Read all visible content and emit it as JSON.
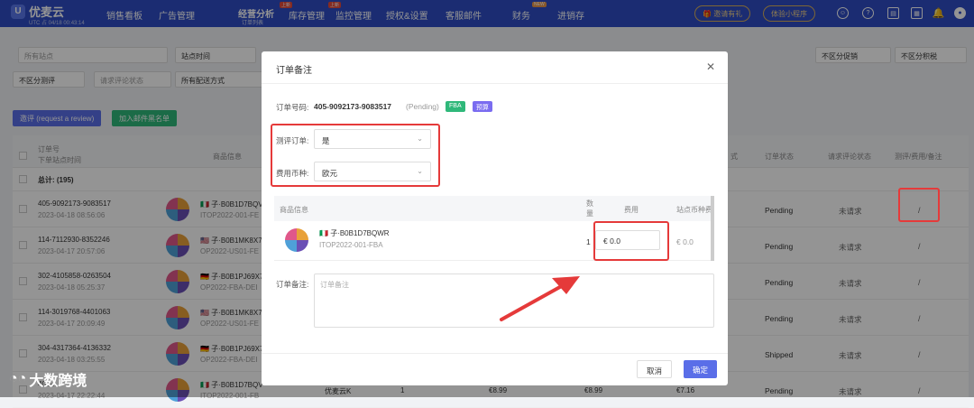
{
  "nav": {
    "logo": "优麦云",
    "logo_sub": "UTC 占 04/18 00:43:14",
    "items": [
      "销售看板",
      "广告管理",
      "经营分析",
      "库存管理",
      "监控管理",
      "授权&设置",
      "客服邮件",
      "财务",
      "进销存"
    ],
    "active_sub": "订单列表",
    "badge_new1": "上新",
    "badge_new2": "上新",
    "badge_new3": "NEW",
    "invite": "邀请有礼",
    "mini_program": "体验小程序"
  },
  "filters": {
    "row1": [
      "所有站点",
      "站点时间",
      "不区分促销",
      "不区分积税"
    ],
    "row2": [
      "不区分测评",
      "请求评论状态",
      "所有配送方式"
    ],
    "btn_review": "邀评 (request a review)",
    "btn_blacklist": "加入邮件黑名单"
  },
  "table": {
    "headers": {
      "order_no": "订单号",
      "order_time": "下单站点时间",
      "product": "商品信息",
      "ship": "式",
      "status": "订单状态",
      "review": "请求评论状态",
      "remark": "测评/费用/备注"
    },
    "total": "总计: (195)",
    "rows": [
      {
        "no": "405-9092173-9083517",
        "date": "2023-04-18 08:56:06",
        "sku": "B0B1D7BQV",
        "msku": "ITOP2022-001-FE",
        "status": "Pending",
        "review": "未请求",
        "remark": "/"
      },
      {
        "no": "114-7112930-8352246",
        "date": "2023-04-17 20:57:06",
        "sku": "B0B1MK8X7",
        "msku": "OP2022-US01-FE",
        "status": "Pending",
        "review": "未请求",
        "remark": "/"
      },
      {
        "no": "302-4105858-0263504",
        "date": "2023-04-18 05:25:37",
        "sku": "B0B1PJ69X7",
        "msku": "OP2022-FBA-DEI",
        "status": "Pending",
        "review": "未请求",
        "remark": "/"
      },
      {
        "no": "114-3019768-4401063",
        "date": "2023-04-17 20:09:49",
        "sku": "B0B1MK8X7",
        "msku": "OP2022-US01-FE",
        "status": "Pending",
        "review": "未请求",
        "remark": "/"
      },
      {
        "no": "304-4317364-4136332",
        "date": "2023-04-18 03:25:55",
        "sku": "B0B1PJ69X7",
        "msku": "OP2022-FBA-DEI",
        "status": "Shipped",
        "review": "未请求",
        "remark": "/"
      },
      {
        "no": "405-...",
        "date": "2023-04-17 22:22:44",
        "sku": "B0B1D7BQV",
        "msku": "ITOP2022-001-FB",
        "status": "Pending",
        "review": "未请求",
        "remark": "/"
      }
    ],
    "last_row_extra": {
      "shop": "优麦云K",
      "qty": "1",
      "price": "€8.99",
      "fee": "€8.99",
      "site_fee": "€7.16"
    }
  },
  "modal": {
    "title": "订单备注",
    "order_label": "订单号码:",
    "order_no": "405-9092173-9083517",
    "order_status": "(Pending)",
    "tag_fba": "FBA",
    "tag_pre": "预算",
    "eval_label": "测评订单:",
    "eval_value": "是",
    "currency_label": "费用币种:",
    "currency_value": "欧元",
    "item_head_product": "商品信息",
    "item_head_qty": "数量",
    "item_head_fee": "费用",
    "item_head_site_fee": "站点币种费",
    "item_sku": "子·B0B1D7BQWR",
    "item_msku": "ITOP2022-001-FBA",
    "item_qty": "1",
    "item_fee_prefix": "€",
    "item_fee_value": "0.0",
    "item_site_fee": "€ 0.0",
    "remark_label": "订单备注:",
    "remark_placeholder": "订单备注",
    "cancel": "取消",
    "confirm": "确定"
  },
  "watermark": "大数跨境",
  "colors": {
    "nav": "#2f4dc4",
    "primary": "#5a6ee8",
    "green": "#2fb87a",
    "purple": "#7a6cf0",
    "highlight": "#e53a3a"
  }
}
